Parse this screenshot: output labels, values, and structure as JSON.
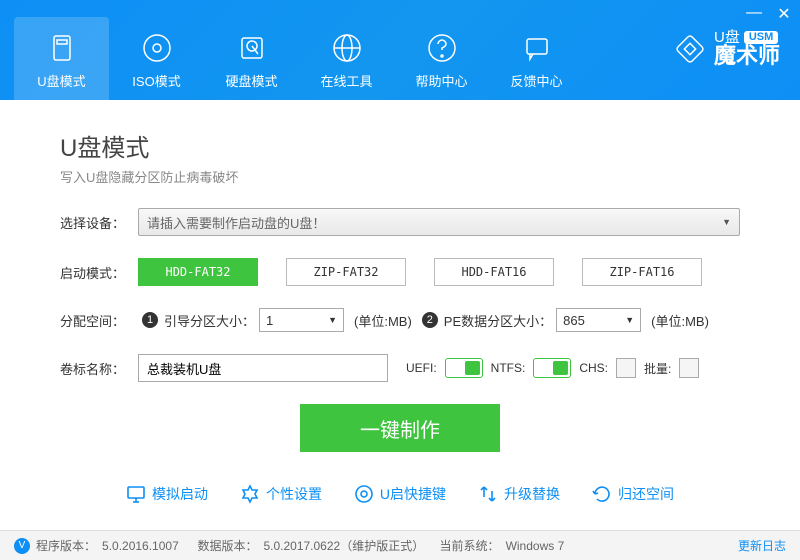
{
  "window": {
    "minimize": "—",
    "close": "✕"
  },
  "tabs": [
    {
      "label": "U盘模式"
    },
    {
      "label": "ISO模式"
    },
    {
      "label": "硬盘模式"
    },
    {
      "label": "在线工具"
    },
    {
      "label": "帮助中心"
    },
    {
      "label": "反馈中心"
    }
  ],
  "logo": {
    "brand": "U盘",
    "badge": "USM",
    "sub": "魔术师"
  },
  "page": {
    "title": "U盘模式",
    "subtitle": "写入U盘隐藏分区防止病毒破坏"
  },
  "labels": {
    "device": "选择设备：",
    "boot": "启动模式：",
    "alloc": "分配空间：",
    "bootPart": "引导分区大小：",
    "peData": "PE数据分区大小：",
    "unit": "(单位:MB)",
    "volume": "卷标名称：",
    "uefi": "UEFI:",
    "ntfs": "NTFS:",
    "chs": "CHS:",
    "batch": "批量:"
  },
  "device": {
    "placeholder": "请插入需要制作启动盘的U盘！"
  },
  "modes": [
    "HDD-FAT32",
    "ZIP-FAT32",
    "HDD-FAT16",
    "ZIP-FAT16"
  ],
  "alloc": {
    "boot": "1",
    "pe": "865"
  },
  "volume": {
    "value": "总裁装机U盘"
  },
  "mainButton": "一键制作",
  "tools": [
    "模拟启动",
    "个性设置",
    "U启快捷键",
    "升级替换",
    "归还空间"
  ],
  "status": {
    "progLabel": "程序版本：",
    "progVer": "5.0.2016.1007",
    "dataLabel": "数据版本：",
    "dataVer": "5.0.2017.0622（维护版正式）",
    "osLabel": "当前系统：",
    "os": "Windows 7",
    "update": "更新日志"
  }
}
